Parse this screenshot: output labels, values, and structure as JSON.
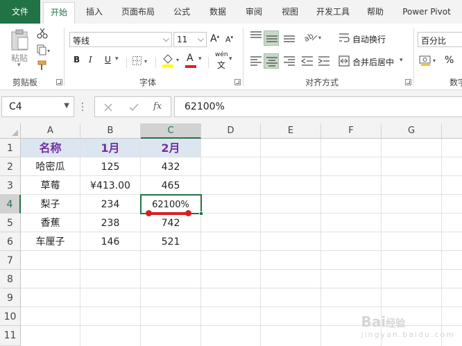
{
  "tabs": [
    {
      "label": "文件"
    },
    {
      "label": "开始"
    },
    {
      "label": "插入"
    },
    {
      "label": "页面布局"
    },
    {
      "label": "公式"
    },
    {
      "label": "数据"
    },
    {
      "label": "审阅"
    },
    {
      "label": "视图"
    },
    {
      "label": "开发工具"
    },
    {
      "label": "帮助"
    },
    {
      "label": "Power Pivot"
    }
  ],
  "ribbon": {
    "clipboard": {
      "paste": "粘贴",
      "group": "剪贴板"
    },
    "font": {
      "name": "等线",
      "size": "11",
      "grow": "A",
      "shrink": "A",
      "bold": "B",
      "italic": "I",
      "underline": "U",
      "font_color": "A",
      "phonetic": "wén",
      "phonetic_char": "文",
      "group": "字体"
    },
    "alignment": {
      "wrap": "自动换行",
      "merge": "合并后居中",
      "group": "对齐方式"
    },
    "number": {
      "format": "百分比",
      "percent": "%",
      "group": "数字"
    }
  },
  "formula_bar": {
    "name_box": "C4",
    "fx": "fx",
    "content": "62100%"
  },
  "grid": {
    "columns": [
      "A",
      "B",
      "C",
      "D",
      "E",
      "F",
      "G"
    ],
    "rows": [
      "1",
      "2",
      "3",
      "4",
      "5",
      "6",
      "7",
      "8",
      "9",
      "10",
      "11"
    ],
    "header_row": [
      "名称",
      "1月",
      "2月"
    ],
    "data_rows": [
      [
        "哈密瓜",
        "125",
        "432"
      ],
      [
        "草莓",
        "¥413.00",
        "465"
      ],
      [
        "梨子",
        "234",
        "62100%"
      ],
      [
        "香蕉",
        "238",
        "742"
      ],
      [
        "车厘子",
        "146",
        "521"
      ]
    ]
  },
  "watermark": {
    "brand": "Bai",
    "brand_suffix": "经验",
    "tagline": "jingyan.baidu.com"
  },
  "colors": {
    "excel_green": "#217346",
    "header_fill": "#dce6f1",
    "header_text": "#7030a0",
    "annotation_red": "#d81e1e"
  }
}
